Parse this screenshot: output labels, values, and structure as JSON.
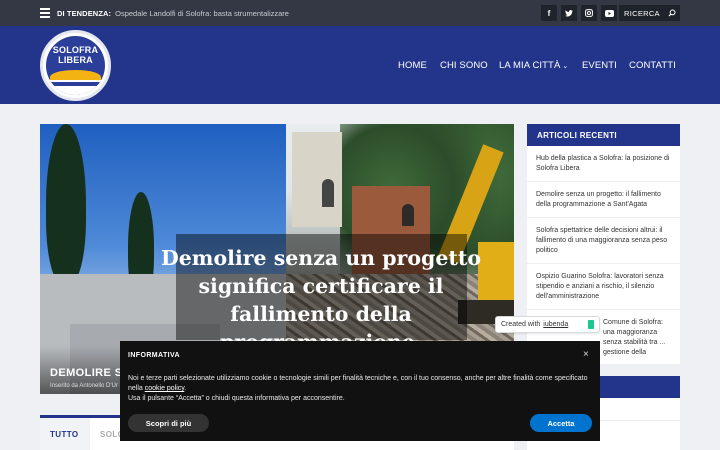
{
  "topbar": {
    "trending_label": "DI TENDENZA:",
    "trending_text": "Ospedale Landolfi di Solofra: basta strumentalizzare",
    "social_icons": [
      "facebook-icon",
      "twitter-icon",
      "instagram-icon",
      "youtube-icon"
    ],
    "search_label": "RICERCA"
  },
  "header": {
    "logo_line1": "SOLOFRA",
    "logo_line2": "LIBERA",
    "nav": [
      {
        "label": "HOME"
      },
      {
        "label": "CHI SONO"
      },
      {
        "label": "LA MIA CITTÀ",
        "has_dropdown": true
      },
      {
        "label": "EVENTI"
      },
      {
        "label": "CONTATTI"
      }
    ]
  },
  "featured": {
    "image_caption": "Demolire senza un progetto significa certificare il fallimento della programmazione.",
    "title": "DEMOLIRE SEI",
    "meta": "Inserito da Antonello D'Ur"
  },
  "tabs": [
    {
      "label": "TUTTO",
      "active": true
    },
    {
      "label": "SOLO",
      "active": false
    }
  ],
  "sidebar": {
    "heading": "ARTICOLI RECENTI",
    "items": [
      {
        "label": "Hub della plastica a Solofra: la posizione di Solofra Libera"
      },
      {
        "label": "Demolire senza un progetto: il fallimento della programmazione a Sant'Agata"
      },
      {
        "label": "Solofra spettatrice delle decisioni altrui: il fallimento di una maggioranza senza peso politico"
      },
      {
        "label": "Ospizio Guarino Solofra: lavoratori senza stipendio e anziani a rischio, il silenzio dell'amministrazione"
      },
      {
        "label": "Comune di Solofra: una maggioranza senza stabilità tra ... gestione della"
      }
    ]
  },
  "iubenda": {
    "prefix": "Created with",
    "link": "iubenda"
  },
  "cookie": {
    "title": "INFORMATIVA",
    "body_1": "Noi e terze parti selezionate utilizziamo cookie o tecnologie simili per finalità tecniche e, con il tuo consenso, anche per altre finalità come specificato nella ",
    "policy_link": "cookie policy",
    "body_2": ".",
    "body_3": "Usa il pulsante “Accetta” o chiudi questa informativa per acconsentire.",
    "more_label": "Scopri di più",
    "accept_label": "Accetta",
    "close_symbol": "×"
  },
  "colors": {
    "brand_blue": "#23358a",
    "topbar": "#333844",
    "accept_blue": "#0073ce",
    "logo_sun": "#f2b313",
    "iubenda_green": "#1cc691"
  }
}
